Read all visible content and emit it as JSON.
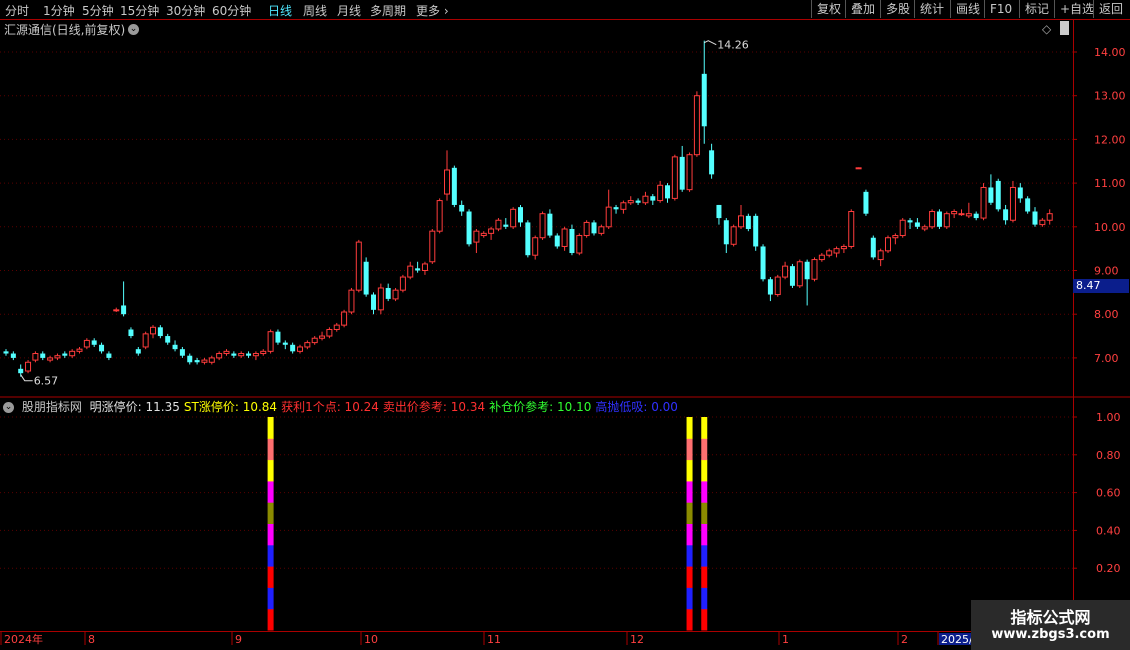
{
  "toolbar": {
    "periods": [
      "分时",
      "1分钟",
      "5分钟",
      "15分钟",
      "30分钟",
      "60分钟",
      "日线",
      "周线",
      "月线",
      "多周期",
      "更多"
    ],
    "active_period": "日线",
    "buttons": [
      "复权",
      "叠加",
      "多股",
      "统计",
      "画线",
      "F10",
      "标记",
      "+自选",
      "返回"
    ]
  },
  "stock_title": "汇源通信(日线,前复权)",
  "indicator": {
    "name": "股朋指标网",
    "items": [
      {
        "label": "明涨停价:",
        "value": "11.35",
        "color": "#e0e0e0"
      },
      {
        "label": "ST涨停价:",
        "value": "10.84",
        "color": "#ffff00"
      },
      {
        "label": "获利1个点:",
        "value": "10.24",
        "color": "#ff3030"
      },
      {
        "label": "卖出价参考:",
        "value": "10.34",
        "color": "#ff3030"
      },
      {
        "label": "补仓价参考:",
        "value": "10.10",
        "color": "#30ff30"
      },
      {
        "label": "高抛低吸:",
        "value": "0.00",
        "color": "#3030ff"
      }
    ]
  },
  "price_axis": {
    "ticks": [
      "14.00",
      "13.00",
      "12.00",
      "11.00",
      "10.00",
      "9.00",
      "8.00",
      "7.00"
    ]
  },
  "current_price": "8.47",
  "max_label": "14.26",
  "min_label": "6.57",
  "indicator_axis": {
    "ticks": [
      "1.00",
      "0.80",
      "0.60",
      "0.40",
      "0.20"
    ]
  },
  "date_axis": {
    "labels": [
      "2024年",
      "8",
      "9",
      "10",
      "11",
      "12",
      "1",
      "2",
      "2025/"
    ]
  },
  "watermark": {
    "title": "指标公式网",
    "url": "www.zbgs3.com"
  },
  "colors": {
    "up": "#ff3c3c",
    "down": "#54ffff",
    "grid": "#5a0000",
    "axis": "#aa0000"
  },
  "chart_data": {
    "type": "candlestick",
    "ylim": [
      6.3,
      14.6
    ],
    "candles": [
      [
        7.15,
        7.2,
        7.05,
        7.1
      ],
      [
        7.1,
        7.15,
        6.95,
        7.0
      ],
      [
        6.75,
        6.85,
        6.57,
        6.65
      ],
      [
        6.7,
        6.95,
        6.65,
        6.9
      ],
      [
        6.95,
        7.15,
        6.9,
        7.1
      ],
      [
        7.1,
        7.15,
        6.95,
        7.0
      ],
      [
        6.95,
        7.05,
        6.9,
        7.0
      ],
      [
        7.0,
        7.1,
        6.95,
        7.05
      ],
      [
        7.1,
        7.15,
        7.0,
        7.05
      ],
      [
        7.05,
        7.2,
        7.0,
        7.15
      ],
      [
        7.15,
        7.25,
        7.1,
        7.2
      ],
      [
        7.25,
        7.45,
        7.2,
        7.4
      ],
      [
        7.4,
        7.45,
        7.25,
        7.3
      ],
      [
        7.3,
        7.35,
        7.1,
        7.15
      ],
      [
        7.1,
        7.15,
        6.95,
        7.0
      ],
      [
        8.1,
        8.15,
        8.05,
        8.1
      ],
      [
        8.2,
        8.75,
        7.95,
        8.0
      ],
      [
        7.65,
        7.7,
        7.45,
        7.5
      ],
      [
        7.2,
        7.25,
        7.05,
        7.1
      ],
      [
        7.25,
        7.6,
        7.2,
        7.55
      ],
      [
        7.55,
        7.75,
        7.45,
        7.7
      ],
      [
        7.7,
        7.75,
        7.45,
        7.5
      ],
      [
        7.5,
        7.55,
        7.3,
        7.35
      ],
      [
        7.3,
        7.4,
        7.15,
        7.2
      ],
      [
        7.2,
        7.25,
        7.0,
        7.05
      ],
      [
        7.05,
        7.1,
        6.85,
        6.9
      ],
      [
        6.95,
        7.0,
        6.85,
        6.9
      ],
      [
        6.9,
        7.0,
        6.85,
        6.95
      ],
      [
        6.9,
        7.05,
        6.85,
        7.0
      ],
      [
        7.0,
        7.15,
        6.95,
        7.1
      ],
      [
        7.1,
        7.2,
        7.05,
        7.15
      ],
      [
        7.1,
        7.15,
        7.0,
        7.05
      ],
      [
        7.05,
        7.15,
        7.0,
        7.1
      ],
      [
        7.1,
        7.15,
        7.0,
        7.05
      ],
      [
        7.05,
        7.15,
        6.95,
        7.1
      ],
      [
        7.1,
        7.2,
        7.05,
        7.15
      ],
      [
        7.15,
        7.65,
        7.1,
        7.6
      ],
      [
        7.6,
        7.65,
        7.3,
        7.35
      ],
      [
        7.35,
        7.4,
        7.2,
        7.3
      ],
      [
        7.3,
        7.35,
        7.1,
        7.15
      ],
      [
        7.15,
        7.3,
        7.1,
        7.25
      ],
      [
        7.25,
        7.4,
        7.2,
        7.35
      ],
      [
        7.35,
        7.5,
        7.3,
        7.45
      ],
      [
        7.45,
        7.6,
        7.4,
        7.5
      ],
      [
        7.5,
        7.7,
        7.45,
        7.65
      ],
      [
        7.65,
        7.8,
        7.6,
        7.75
      ],
      [
        7.75,
        8.1,
        7.7,
        8.05
      ],
      [
        8.05,
        8.6,
        8.0,
        8.55
      ],
      [
        8.55,
        9.7,
        8.5,
        9.65
      ],
      [
        9.2,
        9.3,
        8.4,
        8.45
      ],
      [
        8.45,
        8.5,
        8.0,
        8.1
      ],
      [
        8.1,
        8.7,
        8.0,
        8.6
      ],
      [
        8.6,
        8.7,
        8.3,
        8.35
      ],
      [
        8.35,
        8.6,
        8.3,
        8.55
      ],
      [
        8.55,
        8.9,
        8.5,
        8.85
      ],
      [
        8.85,
        9.2,
        8.8,
        9.1
      ],
      [
        9.05,
        9.2,
        8.95,
        9.0
      ],
      [
        9.0,
        9.2,
        8.9,
        9.15
      ],
      [
        9.2,
        9.95,
        9.15,
        9.9
      ],
      [
        9.9,
        10.65,
        9.85,
        10.6
      ],
      [
        10.75,
        11.75,
        10.6,
        11.3
      ],
      [
        11.35,
        11.4,
        10.45,
        10.5
      ],
      [
        10.5,
        10.6,
        10.25,
        10.35
      ],
      [
        10.35,
        10.4,
        9.55,
        9.6
      ],
      [
        9.65,
        9.95,
        9.4,
        9.9
      ],
      [
        9.8,
        9.9,
        9.75,
        9.85
      ],
      [
        9.85,
        10.0,
        9.7,
        9.95
      ],
      [
        9.95,
        10.2,
        9.9,
        10.15
      ],
      [
        10.05,
        10.2,
        9.95,
        10.0
      ],
      [
        10.0,
        10.45,
        9.95,
        10.4
      ],
      [
        10.45,
        10.5,
        10.0,
        10.1
      ],
      [
        10.1,
        10.15,
        9.3,
        9.35
      ],
      [
        9.35,
        9.8,
        9.25,
        9.75
      ],
      [
        9.75,
        10.35,
        9.7,
        10.3
      ],
      [
        10.3,
        10.4,
        9.75,
        9.8
      ],
      [
        9.8,
        9.85,
        9.5,
        9.55
      ],
      [
        9.55,
        10.0,
        9.45,
        9.95
      ],
      [
        9.95,
        10.05,
        9.35,
        9.4
      ],
      [
        9.4,
        9.85,
        9.35,
        9.8
      ],
      [
        9.8,
        10.15,
        9.75,
        10.1
      ],
      [
        10.1,
        10.15,
        9.8,
        9.85
      ],
      [
        9.85,
        10.05,
        9.8,
        10.0
      ],
      [
        10.0,
        10.85,
        9.95,
        10.45
      ],
      [
        10.45,
        10.5,
        10.3,
        10.4
      ],
      [
        10.4,
        10.6,
        10.3,
        10.55
      ],
      [
        10.55,
        10.7,
        10.5,
        10.6
      ],
      [
        10.6,
        10.65,
        10.5,
        10.55
      ],
      [
        10.55,
        10.8,
        10.5,
        10.7
      ],
      [
        10.7,
        10.75,
        10.5,
        10.6
      ],
      [
        10.6,
        11.05,
        10.55,
        10.95
      ],
      [
        10.95,
        11.0,
        10.55,
        10.65
      ],
      [
        10.65,
        11.65,
        10.6,
        11.6
      ],
      [
        11.6,
        11.85,
        10.8,
        10.85
      ],
      [
        10.85,
        11.7,
        10.8,
        11.65
      ],
      [
        11.65,
        13.1,
        11.6,
        13.0
      ],
      [
        13.5,
        14.26,
        11.9,
        12.3
      ],
      [
        11.75,
        11.9,
        11.1,
        11.2
      ],
      [
        10.5,
        10.5,
        10.05,
        10.2
      ],
      [
        10.15,
        10.2,
        9.4,
        9.6
      ],
      [
        9.6,
        10.05,
        9.55,
        10.0
      ],
      [
        10.0,
        10.5,
        9.95,
        10.25
      ],
      [
        10.25,
        10.3,
        9.9,
        9.95
      ],
      [
        10.25,
        10.3,
        9.45,
        9.55
      ],
      [
        9.55,
        9.6,
        8.75,
        8.8
      ],
      [
        8.8,
        8.85,
        8.3,
        8.45
      ],
      [
        8.45,
        8.9,
        8.4,
        8.85
      ],
      [
        8.85,
        9.2,
        8.8,
        9.1
      ],
      [
        9.1,
        9.15,
        8.6,
        8.65
      ],
      [
        8.65,
        9.25,
        8.6,
        9.2
      ],
      [
        9.2,
        9.25,
        8.2,
        8.8
      ],
      [
        8.8,
        9.3,
        8.75,
        9.25
      ],
      [
        9.25,
        9.4,
        9.2,
        9.35
      ],
      [
        9.35,
        9.5,
        9.3,
        9.45
      ],
      [
        9.4,
        9.55,
        9.3,
        9.5
      ],
      [
        9.5,
        9.6,
        9.4,
        9.55
      ],
      [
        9.55,
        10.4,
        9.5,
        10.35
      ],
      [
        11.35,
        11.36,
        11.34,
        11.35
      ],
      [
        10.8,
        10.85,
        10.25,
        10.3
      ],
      [
        9.75,
        9.8,
        9.25,
        9.3
      ],
      [
        9.25,
        9.5,
        9.1,
        9.45
      ],
      [
        9.45,
        9.8,
        9.4,
        9.75
      ],
      [
        9.75,
        9.85,
        9.6,
        9.8
      ],
      [
        9.8,
        10.2,
        9.75,
        10.15
      ],
      [
        10.15,
        10.2,
        9.95,
        10.1
      ],
      [
        10.1,
        10.2,
        9.95,
        10.0
      ],
      [
        9.95,
        10.05,
        9.9,
        10.0
      ],
      [
        10.0,
        10.4,
        9.95,
        10.35
      ],
      [
        10.35,
        10.4,
        9.95,
        10.0
      ],
      [
        10.0,
        10.35,
        9.95,
        10.3
      ],
      [
        10.3,
        10.4,
        10.2,
        10.35
      ],
      [
        10.3,
        10.4,
        10.25,
        10.3
      ],
      [
        10.25,
        10.55,
        10.2,
        10.3
      ],
      [
        10.3,
        10.35,
        10.15,
        10.2
      ],
      [
        10.2,
        11.0,
        10.15,
        10.9
      ],
      [
        10.9,
        11.2,
        10.5,
        10.55
      ],
      [
        11.05,
        11.1,
        10.35,
        10.4
      ],
      [
        10.4,
        10.5,
        10.05,
        10.15
      ],
      [
        10.15,
        11.05,
        10.1,
        10.9
      ],
      [
        10.9,
        11.0,
        10.55,
        10.65
      ],
      [
        10.65,
        10.7,
        10.3,
        10.35
      ],
      [
        10.35,
        10.45,
        10.0,
        10.05
      ],
      [
        10.05,
        10.2,
        10.0,
        10.15
      ],
      [
        10.15,
        10.4,
        10.05,
        10.3
      ]
    ],
    "signal_bars": [
      {
        "candle_index": 36,
        "value": 1.0
      },
      {
        "candle_index": 93,
        "value": 1.0
      },
      {
        "candle_index": 95,
        "value": 1.0
      }
    ]
  }
}
